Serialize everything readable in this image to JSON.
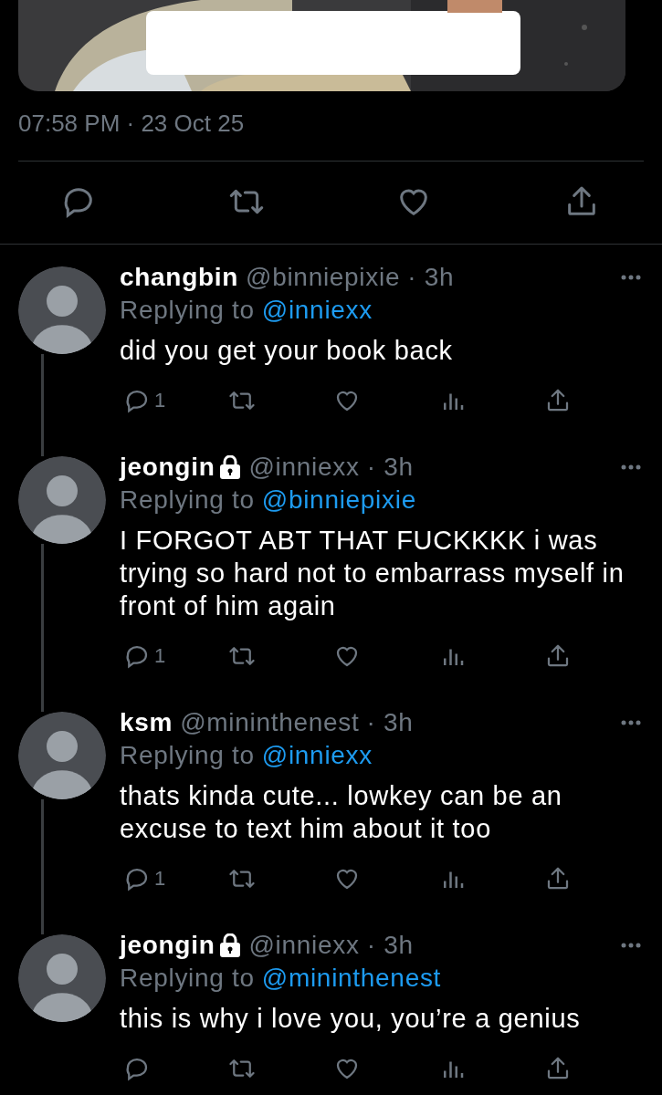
{
  "tweet": {
    "timestamp": "07:58 PM · 23 Oct 25"
  },
  "replies": [
    {
      "name": "changbin",
      "locked": false,
      "handle": "@binniepixie",
      "time": "· 3h",
      "replying_label": "Replying to",
      "replying_to": "@inniexx",
      "text": "did you get your book back",
      "reply_count": "1"
    },
    {
      "name": "jeongin",
      "locked": true,
      "handle": "@inniexx",
      "time": "· 3h",
      "replying_label": "Replying to",
      "replying_to": "@binniepixie",
      "text": "I FORGOT ABT THAT FUCKKKK i was trying so hard not to embarrass myself in front of him again",
      "reply_count": "1"
    },
    {
      "name": "ksm",
      "locked": false,
      "handle": "@mininthenest",
      "time": "· 3h",
      "replying_label": "Replying to",
      "replying_to": "@inniexx",
      "text": "thats kinda cute... lowkey can be an excuse to text him about it too",
      "reply_count": "1"
    },
    {
      "name": "jeongin",
      "locked": true,
      "handle": "@inniexx",
      "time": "· 3h",
      "replying_label": "Replying to",
      "replying_to": "@mininthenest",
      "text": "this is why i love you, you’re a genius"
    }
  ]
}
